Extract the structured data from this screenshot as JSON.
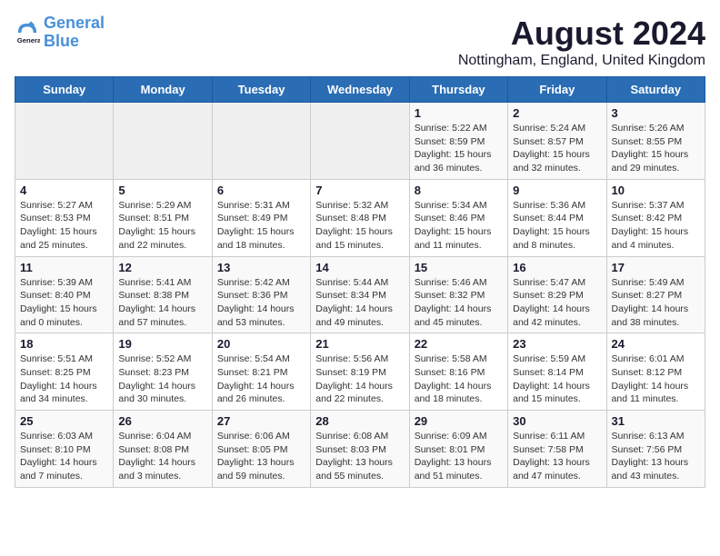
{
  "header": {
    "logo_line1": "General",
    "logo_line2": "Blue",
    "month_year": "August 2024",
    "location": "Nottingham, England, United Kingdom"
  },
  "weekdays": [
    "Sunday",
    "Monday",
    "Tuesday",
    "Wednesday",
    "Thursday",
    "Friday",
    "Saturday"
  ],
  "weeks": [
    [
      {
        "day": "",
        "info": ""
      },
      {
        "day": "",
        "info": ""
      },
      {
        "day": "",
        "info": ""
      },
      {
        "day": "",
        "info": ""
      },
      {
        "day": "1",
        "info": "Sunrise: 5:22 AM\nSunset: 8:59 PM\nDaylight: 15 hours\nand 36 minutes."
      },
      {
        "day": "2",
        "info": "Sunrise: 5:24 AM\nSunset: 8:57 PM\nDaylight: 15 hours\nand 32 minutes."
      },
      {
        "day": "3",
        "info": "Sunrise: 5:26 AM\nSunset: 8:55 PM\nDaylight: 15 hours\nand 29 minutes."
      }
    ],
    [
      {
        "day": "4",
        "info": "Sunrise: 5:27 AM\nSunset: 8:53 PM\nDaylight: 15 hours\nand 25 minutes."
      },
      {
        "day": "5",
        "info": "Sunrise: 5:29 AM\nSunset: 8:51 PM\nDaylight: 15 hours\nand 22 minutes."
      },
      {
        "day": "6",
        "info": "Sunrise: 5:31 AM\nSunset: 8:49 PM\nDaylight: 15 hours\nand 18 minutes."
      },
      {
        "day": "7",
        "info": "Sunrise: 5:32 AM\nSunset: 8:48 PM\nDaylight: 15 hours\nand 15 minutes."
      },
      {
        "day": "8",
        "info": "Sunrise: 5:34 AM\nSunset: 8:46 PM\nDaylight: 15 hours\nand 11 minutes."
      },
      {
        "day": "9",
        "info": "Sunrise: 5:36 AM\nSunset: 8:44 PM\nDaylight: 15 hours\nand 8 minutes."
      },
      {
        "day": "10",
        "info": "Sunrise: 5:37 AM\nSunset: 8:42 PM\nDaylight: 15 hours\nand 4 minutes."
      }
    ],
    [
      {
        "day": "11",
        "info": "Sunrise: 5:39 AM\nSunset: 8:40 PM\nDaylight: 15 hours\nand 0 minutes."
      },
      {
        "day": "12",
        "info": "Sunrise: 5:41 AM\nSunset: 8:38 PM\nDaylight: 14 hours\nand 57 minutes."
      },
      {
        "day": "13",
        "info": "Sunrise: 5:42 AM\nSunset: 8:36 PM\nDaylight: 14 hours\nand 53 minutes."
      },
      {
        "day": "14",
        "info": "Sunrise: 5:44 AM\nSunset: 8:34 PM\nDaylight: 14 hours\nand 49 minutes."
      },
      {
        "day": "15",
        "info": "Sunrise: 5:46 AM\nSunset: 8:32 PM\nDaylight: 14 hours\nand 45 minutes."
      },
      {
        "day": "16",
        "info": "Sunrise: 5:47 AM\nSunset: 8:29 PM\nDaylight: 14 hours\nand 42 minutes."
      },
      {
        "day": "17",
        "info": "Sunrise: 5:49 AM\nSunset: 8:27 PM\nDaylight: 14 hours\nand 38 minutes."
      }
    ],
    [
      {
        "day": "18",
        "info": "Sunrise: 5:51 AM\nSunset: 8:25 PM\nDaylight: 14 hours\nand 34 minutes."
      },
      {
        "day": "19",
        "info": "Sunrise: 5:52 AM\nSunset: 8:23 PM\nDaylight: 14 hours\nand 30 minutes."
      },
      {
        "day": "20",
        "info": "Sunrise: 5:54 AM\nSunset: 8:21 PM\nDaylight: 14 hours\nand 26 minutes."
      },
      {
        "day": "21",
        "info": "Sunrise: 5:56 AM\nSunset: 8:19 PM\nDaylight: 14 hours\nand 22 minutes."
      },
      {
        "day": "22",
        "info": "Sunrise: 5:58 AM\nSunset: 8:16 PM\nDaylight: 14 hours\nand 18 minutes."
      },
      {
        "day": "23",
        "info": "Sunrise: 5:59 AM\nSunset: 8:14 PM\nDaylight: 14 hours\nand 15 minutes."
      },
      {
        "day": "24",
        "info": "Sunrise: 6:01 AM\nSunset: 8:12 PM\nDaylight: 14 hours\nand 11 minutes."
      }
    ],
    [
      {
        "day": "25",
        "info": "Sunrise: 6:03 AM\nSunset: 8:10 PM\nDaylight: 14 hours\nand 7 minutes."
      },
      {
        "day": "26",
        "info": "Sunrise: 6:04 AM\nSunset: 8:08 PM\nDaylight: 14 hours\nand 3 minutes."
      },
      {
        "day": "27",
        "info": "Sunrise: 6:06 AM\nSunset: 8:05 PM\nDaylight: 13 hours\nand 59 minutes."
      },
      {
        "day": "28",
        "info": "Sunrise: 6:08 AM\nSunset: 8:03 PM\nDaylight: 13 hours\nand 55 minutes."
      },
      {
        "day": "29",
        "info": "Sunrise: 6:09 AM\nSunset: 8:01 PM\nDaylight: 13 hours\nand 51 minutes."
      },
      {
        "day": "30",
        "info": "Sunrise: 6:11 AM\nSunset: 7:58 PM\nDaylight: 13 hours\nand 47 minutes."
      },
      {
        "day": "31",
        "info": "Sunrise: 6:13 AM\nSunset: 7:56 PM\nDaylight: 13 hours\nand 43 minutes."
      }
    ]
  ]
}
